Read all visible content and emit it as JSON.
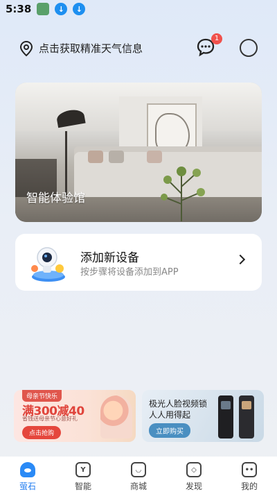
{
  "status_bar": {
    "time": "5:38"
  },
  "header": {
    "location_text": "点击获取精准天气信息",
    "message_badge": "1"
  },
  "room_card": {
    "label": "智能体验馆"
  },
  "add_device": {
    "title": "添加新设备",
    "subtitle": "按步骤将设备添加到APP"
  },
  "banner_left": {
    "tag": "母亲节快乐",
    "title": "满300减40",
    "subtitle": "省钱送母亲节心意好礼",
    "button": "点击抢购"
  },
  "banner_right": {
    "title_line1": "极光人脸视频锁",
    "title_line2": "人人用得起",
    "button": "立即购买"
  },
  "bottom_nav": {
    "items": [
      {
        "label": "萤石",
        "icon": "home-icon",
        "active": true
      },
      {
        "label": "智能",
        "icon": "smart-icon",
        "active": false
      },
      {
        "label": "商城",
        "icon": "shop-bag-icon",
        "active": false
      },
      {
        "label": "发现",
        "icon": "compass-icon",
        "active": false
      },
      {
        "label": "我的",
        "icon": "profile-icon",
        "active": false
      }
    ]
  },
  "colors": {
    "accent": "#1e7bf0",
    "badge": "#f0514c"
  }
}
